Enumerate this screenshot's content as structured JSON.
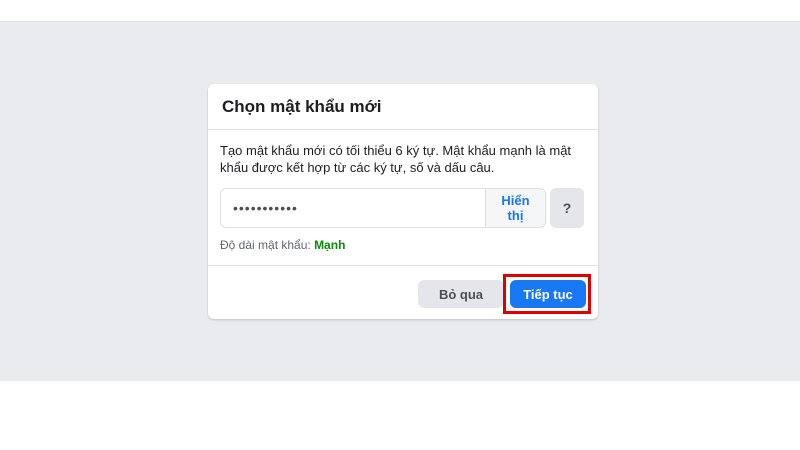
{
  "dialog": {
    "title": "Chọn mật khẩu mới",
    "description": "Tạo mật khẩu mới có tối thiểu 6 ký tự. Mật khẩu mạnh là mật khẩu được kết hợp từ các ký tự, số và dấu câu.",
    "password_value": "•••••••••••",
    "show_label": "Hiển thị",
    "help_label": "?",
    "strength_label": "Độ dài mật khẩu:",
    "strength_value": "Mạnh",
    "skip_label": "Bỏ qua",
    "continue_label": "Tiếp tục"
  },
  "colors": {
    "accent": "#1877f2",
    "strength": "#0a8a0a",
    "highlight": "#e00000",
    "background": "#e9ebee"
  }
}
